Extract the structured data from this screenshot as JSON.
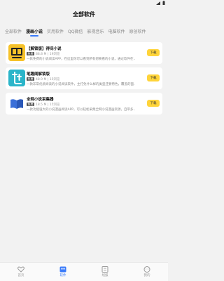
{
  "colors": {
    "accent": "#3a7bfa",
    "download_button": "#ffd43a",
    "badge": "#555555"
  },
  "status_bar": {
    "icons": [
      "signal-icon",
      "battery-icon"
    ]
  },
  "header": {
    "title": "全部软件"
  },
  "tabs": [
    {
      "label": "全部软件",
      "active": false
    },
    {
      "label": "漫画小说",
      "active": true
    },
    {
      "label": "实用软件",
      "active": false
    },
    {
      "label": "QQ微信",
      "active": false
    },
    {
      "label": "影视音乐",
      "active": false
    },
    {
      "label": "电脑软件",
      "active": false
    },
    {
      "label": "原创软件",
      "active": false
    }
  ],
  "apps": [
    {
      "icon": "book-app-icon",
      "name": "【解锁版】得间小说",
      "badge": "免费",
      "size": "88.8 M | 19浏览",
      "description": "一款免费的小说阅读APP，在这里你可以看到所有想要看的小说，通过软件在...",
      "button": "下载"
    },
    {
      "icon": "brush-app-icon",
      "name": "笔趣阁解锁版",
      "badge": "免费",
      "size": "48.9 M | 15浏览",
      "description": "一款非常优质阅读的小说阅读软件，主打免什么样的类型还要特色，覆盖的面...",
      "button": "下载"
    },
    {
      "icon": "open-book-app-icon",
      "name": "全网小说采集器",
      "badge": "免费",
      "size": "18.5 M | 15浏览",
      "description": "一款功能强大的小说漫画阅读APP，可以轻松采集全网小说漫画资源，自带多...",
      "button": "下载"
    }
  ],
  "bottom_nav": [
    {
      "label": "首页",
      "icon": "heart-icon",
      "active": false
    },
    {
      "label": "软件",
      "icon": "grid-icon",
      "active": true
    },
    {
      "label": "线报",
      "icon": "news-icon",
      "active": false
    },
    {
      "label": "我的",
      "icon": "user-icon",
      "active": false
    }
  ]
}
